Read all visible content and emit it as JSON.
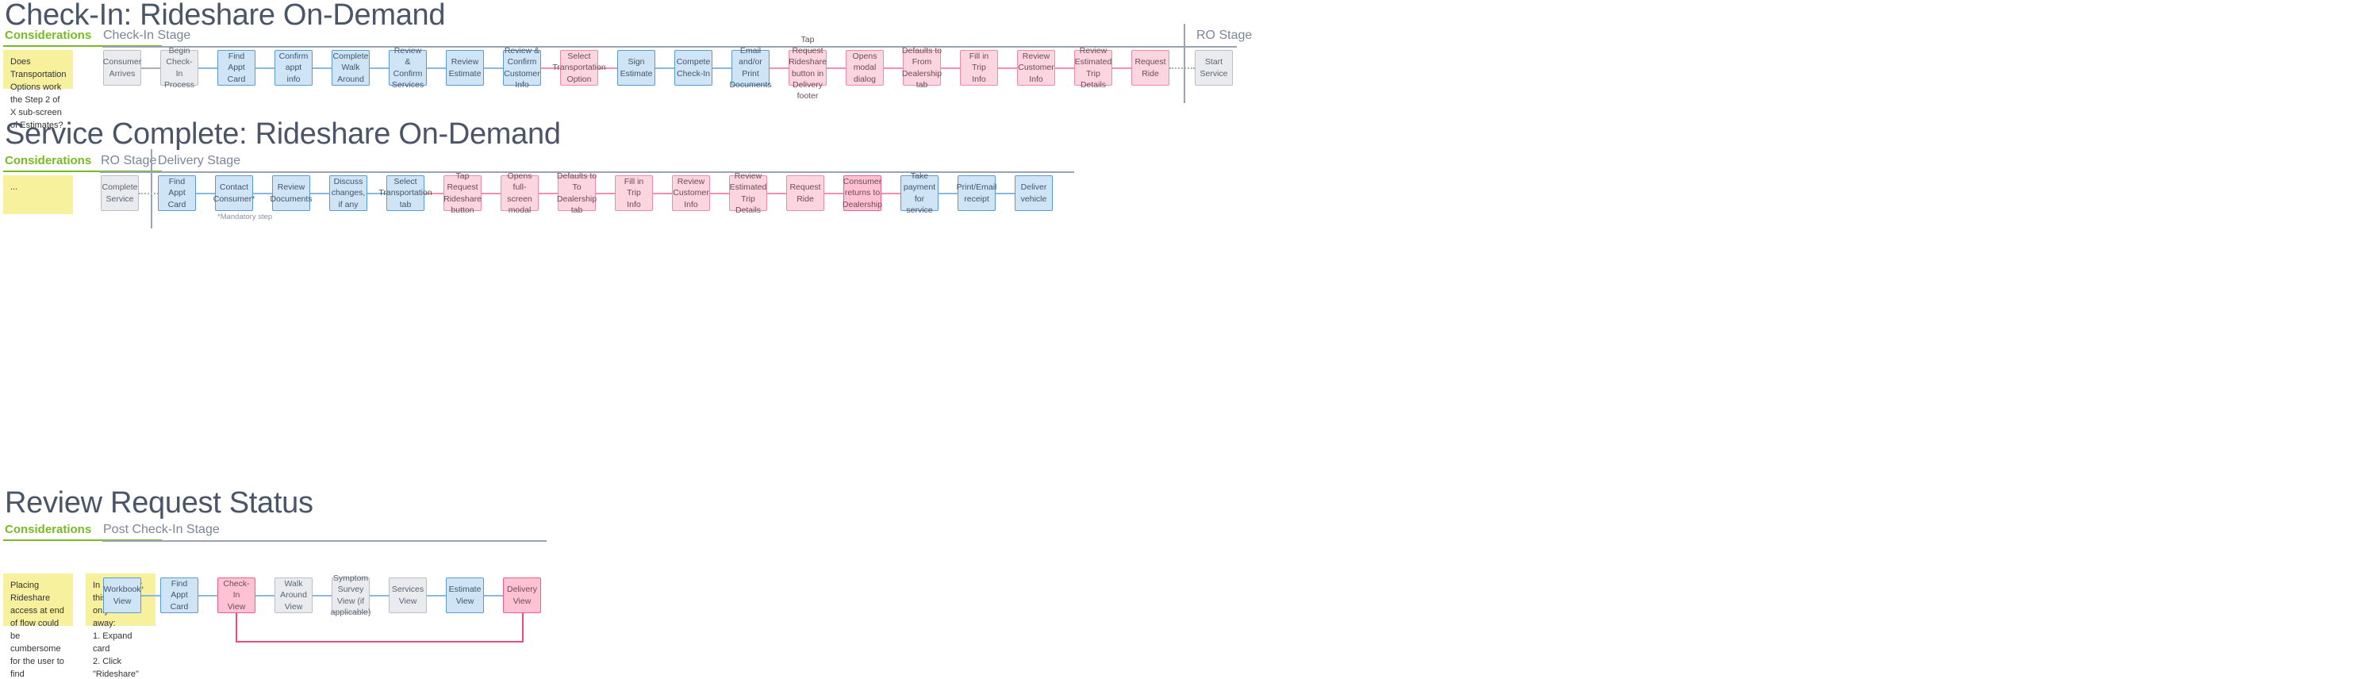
{
  "colors": {
    "green": "#76bc21",
    "gray_node": "#e9ebee",
    "blue_node": "#cfe4f5",
    "pink_node": "#fbd5e0",
    "pink_node_dark": "#ffc2d4",
    "sticky": "#f7f09c",
    "title": "#4a5568"
  },
  "sections": [
    {
      "title": "Check-In: Rideshare On-Demand",
      "considerations_label": "Considerations",
      "stage_labels": [
        "Check-In Stage",
        "RO Stage"
      ],
      "notes": [
        "Does Transportation Options work the Step 2 of X sub-screen of Estimates?"
      ],
      "nodes": [
        {
          "label": "Consumer Arrives",
          "type": "gray"
        },
        {
          "label": "Begin Check-In Process",
          "type": "gray"
        },
        {
          "label": "Find Appt Card",
          "type": "blue"
        },
        {
          "label": "Confirm appt info",
          "type": "blue"
        },
        {
          "label": "Complete Walk Around",
          "type": "blue"
        },
        {
          "label": "Review & Confirm Services",
          "type": "blue"
        },
        {
          "label": "Review Estimate",
          "type": "blue"
        },
        {
          "label": "Review & Confirm Customer Info",
          "type": "blue"
        },
        {
          "label": "Select Transportation Option",
          "type": "pink"
        },
        {
          "label": "Sign Estimate",
          "type": "blue"
        },
        {
          "label": "Compete Check-In",
          "type": "blue"
        },
        {
          "label": "Email and/or Print Documents",
          "type": "blue"
        },
        {
          "label": "Tap Request Rideshare button in Delivery footer",
          "type": "pink"
        },
        {
          "label": "Opens modal dialog",
          "type": "pink"
        },
        {
          "label": "Defaults to From Dealership tab",
          "type": "pink"
        },
        {
          "label": "Fill in Trip Info",
          "type": "pink"
        },
        {
          "label": "Review Customer Info",
          "type": "pink"
        },
        {
          "label": "Review Estimated Trip Details",
          "type": "pink"
        },
        {
          "label": "Request Ride",
          "type": "pink"
        },
        {
          "label": "Start Service",
          "type": "gray"
        }
      ]
    },
    {
      "title": "Service Complete: Rideshare On-Demand",
      "considerations_label": "Considerations",
      "stage_labels": [
        "RO Stage",
        "Delivery Stage"
      ],
      "notes": [
        "..."
      ],
      "footnote": "*Mandatory step",
      "nodes": [
        {
          "label": "Complete Service",
          "type": "gray"
        },
        {
          "label": "Find Appt Card",
          "type": "blue"
        },
        {
          "label": "Contact Consumer*",
          "type": "blue"
        },
        {
          "label": "Review Documents",
          "type": "blue"
        },
        {
          "label": "Discuss changes, if any",
          "type": "blue"
        },
        {
          "label": "Select Transportation tab",
          "type": "blue"
        },
        {
          "label": "Tap Request Rideshare button",
          "type": "pink"
        },
        {
          "label": "Opens full-screen modal",
          "type": "pink"
        },
        {
          "label": "Defaults to To Dealership tab",
          "type": "pink"
        },
        {
          "label": "Fill in Trip Info",
          "type": "pink"
        },
        {
          "label": "Review Customer Info",
          "type": "pink"
        },
        {
          "label": "Review Estimated Trip Details",
          "type": "pink"
        },
        {
          "label": "Request Ride",
          "type": "pink"
        },
        {
          "label": "Consumer returns to Dealership",
          "type": "pinkd"
        },
        {
          "label": "Take payment for service",
          "type": "blue"
        },
        {
          "label": "Print/Email receipt",
          "type": "blue"
        },
        {
          "label": "Deliver vehicle",
          "type": "blue"
        }
      ]
    },
    {
      "title": "Review Request Status",
      "considerations_label": "Considerations",
      "stage_labels": [
        "Post Check-In Stage"
      ],
      "notes": [
        "Placing Rideshare access at end of flow could be cumbersome for the user to find",
        "In Scheduler, this task is only 2 clicks away:\n1. Expand card\n2. Click \"Rideshare\""
      ],
      "nodes": [
        {
          "label": "Workbook View",
          "type": "blue"
        },
        {
          "label": "Find Appt Card",
          "type": "blue"
        },
        {
          "label": "Check-In View",
          "type": "pinkd"
        },
        {
          "label": "Walk Around View",
          "type": "gray"
        },
        {
          "label": "Symptom Survey View (if applicable)",
          "type": "gray"
        },
        {
          "label": "Services View",
          "type": "gray"
        },
        {
          "label": "Estimate View",
          "type": "blue"
        },
        {
          "label": "Delivery View",
          "type": "pinkd"
        }
      ]
    }
  ]
}
